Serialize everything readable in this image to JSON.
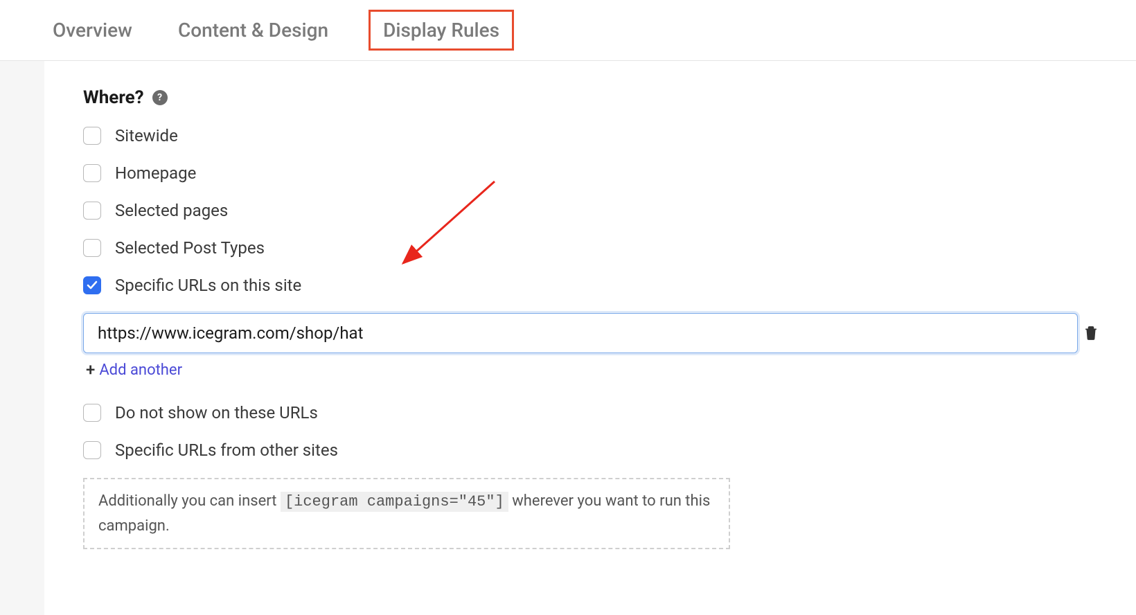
{
  "tabs": {
    "overview": "Overview",
    "content_design": "Content & Design",
    "display_rules": "Display Rules"
  },
  "section": {
    "title": "Where?"
  },
  "options": {
    "sitewide": {
      "label": "Sitewide",
      "checked": false
    },
    "homepage": {
      "label": "Homepage",
      "checked": false
    },
    "selected_pages": {
      "label": "Selected pages",
      "checked": false
    },
    "selected_post_types": {
      "label": "Selected Post Types",
      "checked": false
    },
    "specific_urls": {
      "label": "Specific URLs on this site",
      "checked": true
    },
    "do_not_show": {
      "label": "Do not show on these URLs",
      "checked": false
    },
    "other_sites_urls": {
      "label": "Specific URLs from other sites",
      "checked": false
    }
  },
  "url_input": {
    "value": "https://www.icegram.com/shop/hat"
  },
  "add_another": {
    "label": "Add another"
  },
  "hint": {
    "prefix": "Additionally you can insert ",
    "code": "[icegram campaigns=\"45\"]",
    "suffix": " wherever you want to run this campaign."
  }
}
